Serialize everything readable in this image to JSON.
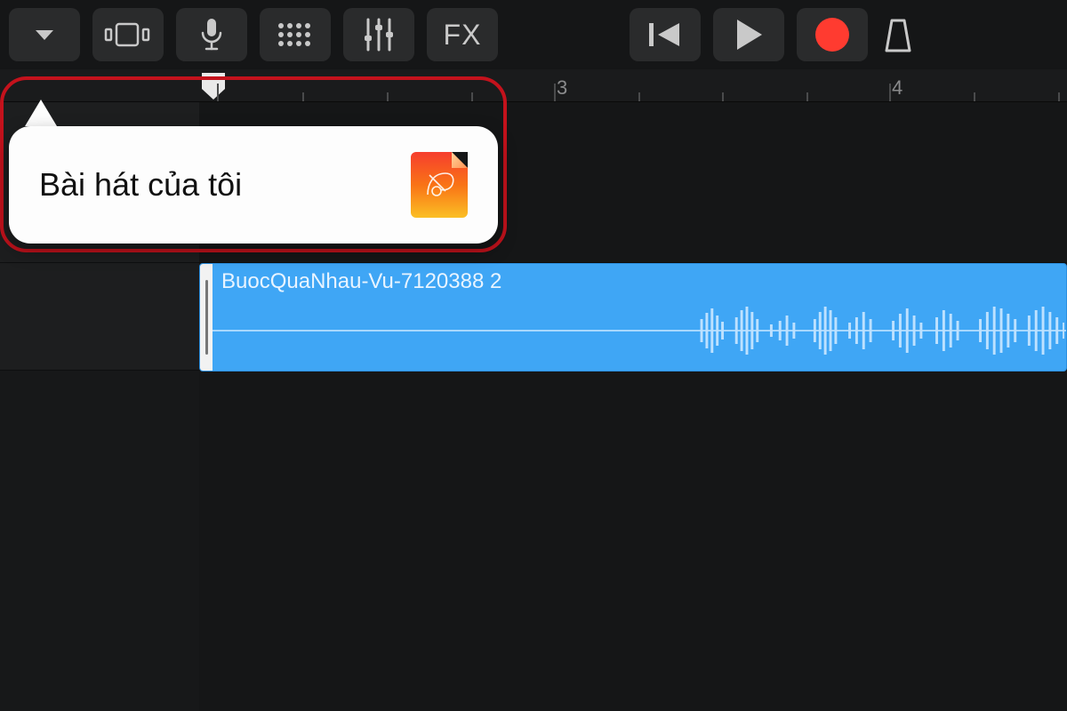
{
  "toolbar": {
    "fx_label": "FX"
  },
  "ruler": {
    "markers": [
      "3",
      "4"
    ]
  },
  "popover": {
    "title": "Bài hát của tôi"
  },
  "track": {
    "region_name": "BuocQuaNhau-Vu-7120388 2"
  },
  "colors": {
    "region": "#3fa6f5",
    "record": "#ff3b30",
    "highlight": "#c4121c"
  }
}
